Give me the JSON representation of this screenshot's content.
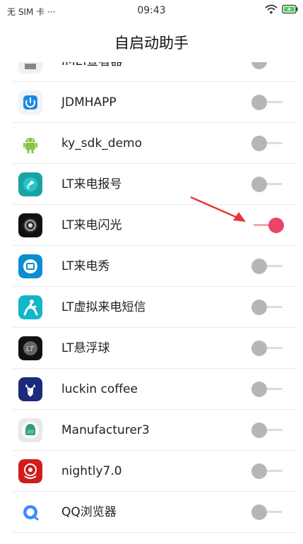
{
  "status": {
    "carrier": "无 SIM 卡 ···",
    "time": "09:43"
  },
  "title": "自启动助手",
  "apps": [
    {
      "label": "IMEI查看器",
      "icon": "imei-icon",
      "enabled": false
    },
    {
      "label": "JDMHAPP",
      "icon": "jdmhapp-icon",
      "enabled": false
    },
    {
      "label": "ky_sdk_demo",
      "icon": "android-robot-icon",
      "enabled": false
    },
    {
      "label": "LT来电报号",
      "icon": "lt-caller-announce-icon",
      "enabled": false
    },
    {
      "label": "LT来电闪光",
      "icon": "lt-flash-icon",
      "enabled": true
    },
    {
      "label": "LT来电秀",
      "icon": "lt-call-show-icon",
      "enabled": false
    },
    {
      "label": "LT虚拟来电短信",
      "icon": "lt-virtual-sms-icon",
      "enabled": false
    },
    {
      "label": "LT悬浮球",
      "icon": "lt-floating-ball-icon",
      "enabled": false
    },
    {
      "label": "luckin coffee",
      "icon": "luckin-deer-icon",
      "enabled": false
    },
    {
      "label": "Manufacturer3",
      "icon": "android-icon",
      "enabled": false
    },
    {
      "label": "nightly7.0",
      "icon": "nightly-icon",
      "enabled": false
    },
    {
      "label": "QQ浏览器",
      "icon": "qq-browser-icon",
      "enabled": false
    }
  ],
  "colors": {
    "toggle_on": "#ec4468",
    "toggle_off": "#b6b6b6",
    "annotation_arrow": "#e8353a"
  }
}
